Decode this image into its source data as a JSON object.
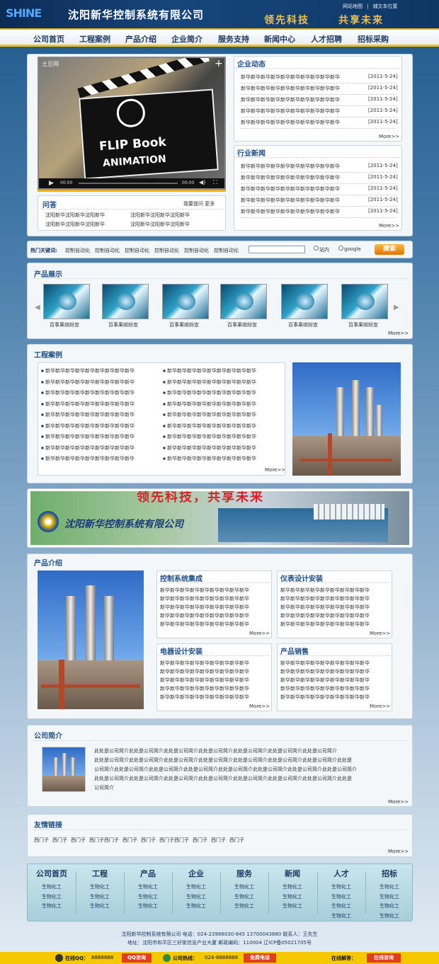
{
  "header": {
    "logo": "SHINE",
    "company": "沈阳新华控制系统有限公司",
    "slogan1": "领先科技",
    "slogan2": "共享未来",
    "toplinks": [
      "网站地图",
      "|",
      "铺文本位置"
    ]
  },
  "nav": [
    "公司首页",
    "工程案例",
    "产品介绍",
    "企业简介",
    "服务支持",
    "新闻中心",
    "人才招聘",
    "招标采购"
  ],
  "video": {
    "watermark": "土豆网",
    "title1": "FLIP Book",
    "title2": "ANIMATION",
    "time1": "00:00",
    "time2": "00:00"
  },
  "qa": {
    "title": "问答",
    "links": "我要提问  更多",
    "items": [
      "沈阳新华沈阳新华沈阳新华",
      "沈阳新华沈阳新华沈阳新华",
      "沈阳新华沈阳新华沈阳新华",
      "沈阳新华沈阳新华沈阳新华"
    ]
  },
  "company_news": {
    "title": "企业动态",
    "items": [
      {
        "t": "新华新华新华新华新华新华新华新华新华新华",
        "d": "[2011-5-24]"
      },
      {
        "t": "新华新华新华新华新华新华新华新华新华新华",
        "d": "[2011-5-24]"
      },
      {
        "t": "新华新华新华新华新华新华新华新华新华新华",
        "d": "[2011-5-24]"
      },
      {
        "t": "新华新华新华新华新华新华新华新华新华新华",
        "d": "[2011-5-24]"
      },
      {
        "t": "新华新华新华新华新华新华新华新华新华新华",
        "d": "[2011-5-24]"
      }
    ],
    "more": "More>>"
  },
  "industry_news": {
    "title": "行业新闻",
    "items": [
      {
        "t": "新华新华新华新华新华新华新华新华新华新华",
        "d": "[2011-5-24]"
      },
      {
        "t": "新华新华新华新华新华新华新华新华新华新华",
        "d": "[2011-5-24]"
      },
      {
        "t": "新华新华新华新华新华新华新华新华新华新华",
        "d": "[2011-5-24]"
      },
      {
        "t": "新华新华新华新华新华新华新华新华新华新华",
        "d": "[2011-5-24]"
      },
      {
        "t": "新华新华新华新华新华新华新华新华新华新华",
        "d": "[2011-5-24]"
      }
    ],
    "more": "More>>"
  },
  "search": {
    "label": "热门关键词:",
    "keywords": [
      "控制自动化",
      "控制自动化",
      "控制自动化",
      "控制自动化",
      "控制自动化",
      "控制自动化"
    ],
    "radio1": "站内",
    "radio2": "google",
    "button": "搜索"
  },
  "products": {
    "title": "产品展示",
    "items": [
      "百事果缤纷宣",
      "百事果缤纷宣",
      "百事果缤纷宣",
      "百事果缤纷宣",
      "百事果缤纷宣",
      "百事果缤纷宣"
    ],
    "more": "More>>"
  },
  "cases": {
    "title": "工程案例",
    "left": [
      "新华新华新华新华新华新华新华新华新华",
      "新华新华新华新华新华新华新华新华新华",
      "新华新华新华新华新华新华新华新华新华",
      "新华新华新华新华新华新华新华新华新华",
      "新华新华新华新华新华新华新华新华新华",
      "新华新华新华新华新华新华新华新华新华",
      "新华新华新华新华新华新华新华新华新华",
      "新华新华新华新华新华新华新华新华新华",
      "新华新华新华新华新华新华新华新华新华"
    ],
    "right": [
      "新华新华新华新华新华新华新华新华新华",
      "新华新华新华新华新华新华新华新华新华",
      "新华新华新华新华新华新华新华新华新华",
      "新华新华新华新华新华新华新华新华新华",
      "新华新华新华新华新华新华新华新华新华",
      "新华新华新华新华新华新华新华新华新华",
      "新华新华新华新华新华新华新华新华新华",
      "新华新华新华新华新华新华新华新华新华",
      "新华新华新华新华新华新华新华新华新华"
    ],
    "more": "More>>"
  },
  "banner": {
    "top": "领先科技，共享未来",
    "company": "沈阳新华控制系统有限公司"
  },
  "intro": {
    "title": "产品介绍",
    "boxes": [
      {
        "title": "控制系统集成",
        "lines": [
          "新华新华新华新华新华新华新华新华新华",
          "新华新华新华新华新华新华新华新华新华",
          "新华新华新华新华新华新华新华新华新华",
          "新华新华新华新华新华新华新华新华新华",
          "新华新华新华新华新华新华新华新华新华"
        ],
        "more": "More>>"
      },
      {
        "title": "仪表设计安装",
        "lines": [
          "新华新华新华新华新华新华新华新华新华",
          "新华新华新华新华新华新华新华新华新华",
          "新华新华新华新华新华新华新华新华新华",
          "新华新华新华新华新华新华新华新华新华",
          "新华新华新华新华新华新华新华新华新华"
        ],
        "more": "More>>"
      },
      {
        "title": "电器设计安装",
        "lines": [
          "新华新华新华新华新华新华新华新华新华",
          "新华新华新华新华新华新华新华新华新华",
          "新华新华新华新华新华新华新华新华新华",
          "新华新华新华新华新华新华新华新华新华",
          "新华新华新华新华新华新华新华新华新华"
        ],
        "more": "More>>"
      },
      {
        "title": "产品销售",
        "lines": [
          "新华新华新华新华新华新华新华新华新华",
          "新华新华新华新华新华新华新华新华新华",
          "新华新华新华新华新华新华新华新华新华",
          "新华新华新华新华新华新华新华新华新华",
          "新华新华新华新华新华新华新华新华新华"
        ],
        "more": "More>>"
      }
    ]
  },
  "about": {
    "title": "公司简介",
    "lines": [
      "此处是公司简介此处是公司简介此处是公司简介此处是公司简介此处是公司简介此处是公司简介此处是公司简介",
      "此处是公司简介此处是公司简介此处是公司简介此处是公司简介此处是公司简介此处是公司简介此处是公司简介此处是",
      "公司简介此处是公司简介此处是公司简介此处是公司简介此处是公司简介此处是公司简介此处是公司简介此处是公司简介",
      "此处是公司简介此处是公司简介此处是公司简介此处是公司简介此处是公司简介此处是公司简介此处是公司简介此处是",
      "公司简介"
    ],
    "more": "More>>"
  },
  "links": {
    "title": "友情链接",
    "items": [
      "西门子",
      "西门子",
      "西门子",
      "西门子西门子",
      "西门子",
      "西门子",
      "西门子西门子",
      "西门子",
      "西门子",
      "西门子"
    ],
    "more": "More>>"
  },
  "footer_nav": [
    {
      "h": "公司首页",
      "l": [
        "生物化工",
        "生物化工",
        "生物化工"
      ]
    },
    {
      "h": "工程",
      "l": [
        "生物化工",
        "生物化工",
        "生物化工"
      ]
    },
    {
      "h": "产品",
      "l": [
        "生物化工",
        "生物化工",
        "生物化工"
      ]
    },
    {
      "h": "企业",
      "l": [
        "生物化工",
        "生物化工",
        "生物化工"
      ]
    },
    {
      "h": "服务",
      "l": [
        "生物化工",
        "生物化工",
        "生物化工"
      ]
    },
    {
      "h": "新闻",
      "l": [
        "生物化工",
        "生物化工",
        "生物化工"
      ]
    },
    {
      "h": "人才",
      "l": [
        "生物化工",
        "生物化工",
        "生物化工",
        "生物化工"
      ]
    },
    {
      "h": "招标",
      "l": [
        "生物化工",
        "生物化工",
        "生物化工",
        "生物化工"
      ]
    }
  ],
  "footer": {
    "line1": "沈阳新华控制系统有限公司  电话：024-23988030-845  13700043880  联系人：王先生",
    "line2": "地址：沈阳市和平区三好街信息产业大厦  邮政编码：110004  辽ICP备05021705号"
  },
  "bottombar": {
    "qq_label": "在线QQ：",
    "qq_num": "8888888",
    "qq_btn": "QQ咨询",
    "hotline_label": "公司热线：",
    "hotline_num": "024-8888888",
    "call_btn": "免费电话",
    "online_label": "在线解答：",
    "online_btn": "在线咨询"
  },
  "colors": {
    "nav_text": "#1d3a66",
    "accent_gold": "#f2c01b",
    "title_blue": "#1e4f87",
    "header_bg": "#0c2b55"
  }
}
